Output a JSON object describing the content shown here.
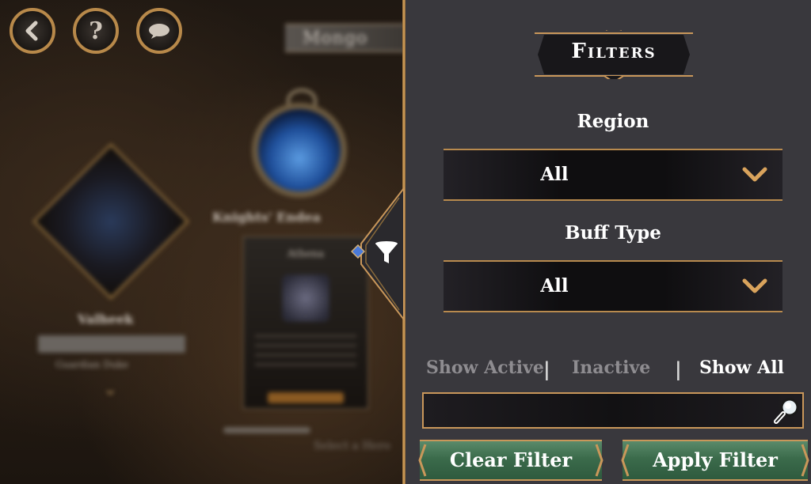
{
  "background": {
    "hero_title": "Mongo",
    "subtitle": "Knights' Endea",
    "card_header": "Athena",
    "hero_name": "Valheek",
    "hero_sub": "Guardian Duke",
    "select_text": "Select a Hero"
  },
  "nav": {
    "back_icon": "chevron-left-icon",
    "help_icon": "question-icon",
    "chat_icon": "chat-bubble-icon"
  },
  "filters": {
    "title": "Filters",
    "region": {
      "label": "Region",
      "value": "All"
    },
    "buff_type": {
      "label": "Buff Type",
      "value": "All"
    },
    "toggles": [
      {
        "label": "Show Active",
        "active": false
      },
      {
        "label": "Inactive",
        "active": false
      },
      {
        "label": "Show All",
        "active": true
      }
    ],
    "search": {
      "value": "",
      "placeholder": ""
    },
    "clear_label": "Clear Filter",
    "apply_label": "Apply Filter"
  },
  "colors": {
    "accent_gold": "#c9975a",
    "panel_bg": "#39383d",
    "button_green": "#3b6b4b",
    "text_active": "#ffffff",
    "text_inactive": "#8e8c90"
  }
}
